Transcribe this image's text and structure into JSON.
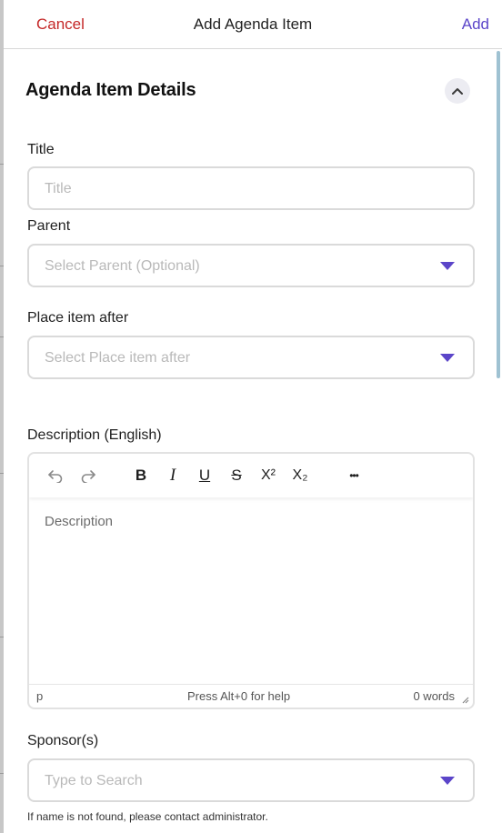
{
  "header": {
    "cancel_label": "Cancel",
    "title": "Add Agenda Item",
    "add_label": "Add"
  },
  "section": {
    "title": "Agenda Item Details"
  },
  "fields": {
    "title": {
      "label": "Title",
      "placeholder": "Title"
    },
    "parent": {
      "label": "Parent",
      "placeholder": "Select Parent (Optional)"
    },
    "place_after": {
      "label": "Place item after",
      "placeholder": "Select Place item after"
    },
    "description": {
      "label": "Description (English)",
      "placeholder": "Description",
      "toolbar": {
        "bold": "B",
        "italic": "I",
        "underline": "U",
        "strikethrough": "S",
        "superscript": "X²",
        "subscript": "X₂",
        "more": "•••"
      },
      "status_path": "p",
      "status_help": "Press Alt+0 for help",
      "status_words": "0 words"
    },
    "sponsors": {
      "label": "Sponsor(s)",
      "placeholder": "Type to Search",
      "helper": "If name is not found, please contact administrator."
    }
  },
  "colors": {
    "cancel": "#c42727",
    "accent": "#5b45c9"
  }
}
